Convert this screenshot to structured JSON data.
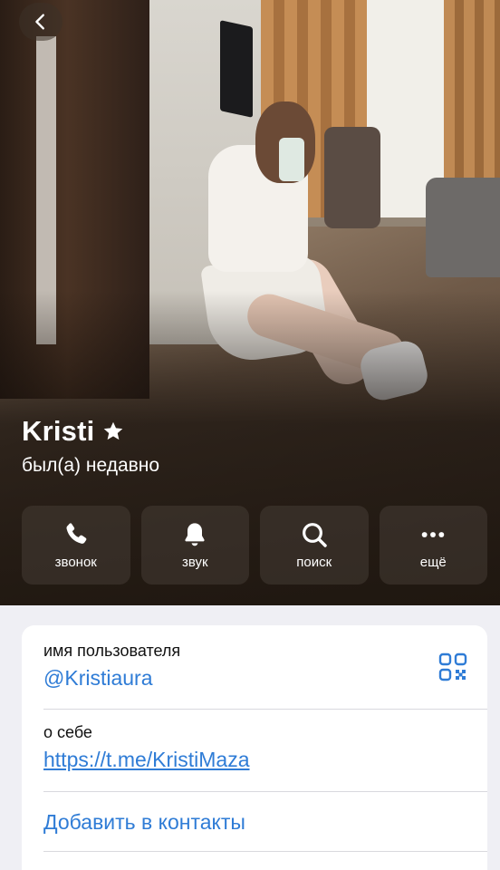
{
  "profile": {
    "name": "Kristi",
    "status": "был(а) недавно"
  },
  "nav": {
    "back_icon": "chevron-left-icon"
  },
  "actions": [
    {
      "label": "звонок",
      "icon": "phone-icon"
    },
    {
      "label": "звук",
      "icon": "bell-icon"
    },
    {
      "label": "поиск",
      "icon": "search-icon"
    },
    {
      "label": "ещё",
      "icon": "more-icon"
    }
  ],
  "info": {
    "username_label": "имя пользователя",
    "username_value": "@Kristiaura",
    "bio_label": "о себе",
    "bio_value": "https://t.me/KristiMaza",
    "add_contact": "Добавить в контакты"
  },
  "colors": {
    "accent": "#2f7cd6",
    "background": "#efeff4"
  }
}
